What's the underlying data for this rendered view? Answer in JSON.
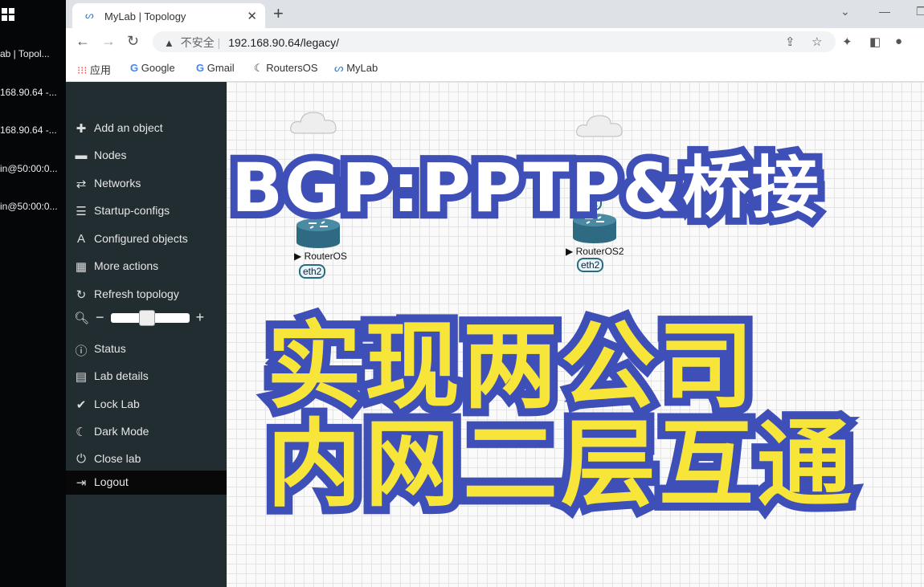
{
  "taskbar": {
    "items": [
      "ab | Topol...",
      "168.90.64 -...",
      "168.90.64 -...",
      "in@50:00:0...",
      "in@50:00:0..."
    ]
  },
  "browser": {
    "tab_title": "MyLab | Topology",
    "security": "不安全",
    "url": "192.168.90.64/legacy/",
    "bookmarks": [
      "应用",
      "Google",
      "Gmail",
      "RoutersOS",
      "MyLab"
    ]
  },
  "sidebar": {
    "items": [
      {
        "icon": "plus-icon",
        "glyph": "✚",
        "label": "Add an object"
      },
      {
        "icon": "server-icon",
        "glyph": "▬",
        "label": "Nodes"
      },
      {
        "icon": "exchange-icon",
        "glyph": "⇄",
        "label": "Networks"
      },
      {
        "icon": "list-icon",
        "glyph": "☰",
        "label": "Startup-configs"
      },
      {
        "icon": "font-icon",
        "glyph": "A",
        "label": "Configured objects"
      },
      {
        "icon": "grid-icon",
        "glyph": "▦",
        "label": "More actions"
      },
      {
        "icon": "refresh-icon",
        "glyph": "↻",
        "label": "Refresh topology"
      },
      {
        "icon": "info-icon",
        "glyph": "ⓘ",
        "label": "Status"
      },
      {
        "icon": "list-alt-icon",
        "glyph": "▤",
        "label": "Lab details"
      },
      {
        "icon": "check-circle-icon",
        "glyph": "✔",
        "label": "Lock Lab"
      },
      {
        "icon": "moon-icon",
        "glyph": "☾",
        "label": "Dark Mode"
      },
      {
        "icon": "power-icon",
        "glyph": "⏻",
        "label": "Close lab"
      },
      {
        "icon": "sign-out-icon",
        "glyph": "⇥",
        "label": "Logout"
      }
    ],
    "zoom_level": 0.45
  },
  "topology": {
    "nodes": [
      {
        "name": "RouterOS",
        "iface_top": "",
        "iface_bottom": "eth2"
      },
      {
        "name": "RouterOS2",
        "iface_top": "e1",
        "iface_bottom": "eth2"
      }
    ]
  },
  "overlay": {
    "title": "BGP:PPTP&桥接",
    "line1": "实现两公司",
    "line2": "内网二层互通"
  },
  "colors": {
    "overlay_stroke": "#3e4fb8",
    "overlay_yellow": "#f8e53a",
    "sidebar": "#222d32"
  }
}
